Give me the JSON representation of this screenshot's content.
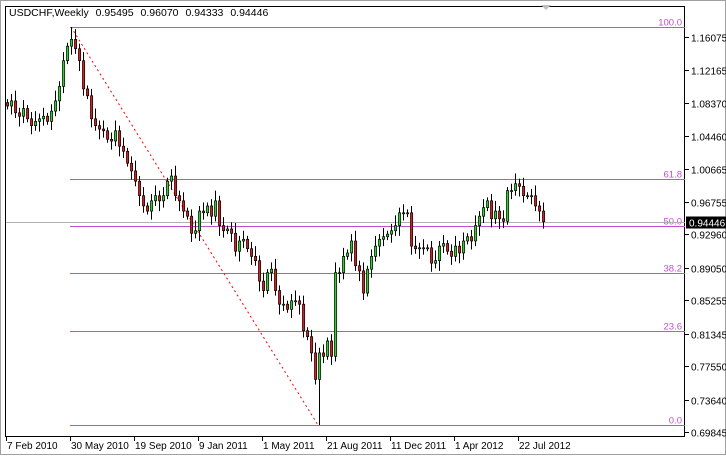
{
  "header": {
    "symbol_timeframe": "USDCHF,Weekly",
    "open": "0.95495",
    "high": "0.96070",
    "low": "0.94333",
    "close": "0.94446"
  },
  "chart_data": {
    "type": "candlestick",
    "symbol": "USDCHF",
    "timeframe": "Weekly",
    "price_ticks": [
      "1.16075",
      "1.12165",
      "1.08370",
      "1.04460",
      "1.00665",
      "0.96755",
      "0.92960",
      "0.89050",
      "0.85255",
      "0.81345",
      "0.77550",
      "0.73640",
      "0.69845"
    ],
    "price_tick_values": [
      1.16075,
      1.12165,
      1.0837,
      1.0446,
      1.00665,
      0.96755,
      0.9296,
      0.8905,
      0.85255,
      0.81345,
      0.7755,
      0.7364,
      0.69845
    ],
    "ylim": [
      0.6935,
      1.2
    ],
    "time_ticks": [
      {
        "label": "7 Feb 2010",
        "week": 0
      },
      {
        "label": "30 May 2010",
        "week": 16
      },
      {
        "label": "19 Sep 2010",
        "week": 32
      },
      {
        "label": "9 Jan 2011",
        "week": 48
      },
      {
        "label": "1 May 2011",
        "week": 64
      },
      {
        "label": "21 Aug 2011",
        "week": 80
      },
      {
        "label": "11 Dec 2011",
        "week": 96
      },
      {
        "label": "1 Apr 2012",
        "week": 112
      },
      {
        "label": "22 Jul 2012",
        "week": 128
      }
    ],
    "current_price": {
      "label": "0.94446",
      "value": 0.94446
    },
    "swing_high": {
      "value": 1.1725,
      "week": 16
    },
    "swing_low": {
      "value": 0.7066,
      "week": 78
    },
    "fibonacci": [
      {
        "label": "100.0",
        "value": 1.1725
      },
      {
        "label": "61.8",
        "value": 0.9946
      },
      {
        "label": "50.0",
        "value": 0.9396
      },
      {
        "label": "38.2",
        "value": 0.8846
      },
      {
        "label": "23.6",
        "value": 0.8166
      },
      {
        "label": "0.0",
        "value": 0.7066
      }
    ],
    "closes": [
      1.08,
      1.086,
      1.072,
      1.068,
      1.077,
      1.065,
      1.057,
      1.062,
      1.065,
      1.068,
      1.062,
      1.074,
      1.086,
      1.103,
      1.133,
      1.15,
      1.158,
      1.147,
      1.133,
      1.1,
      1.092,
      1.065,
      1.057,
      1.053,
      1.051,
      1.041,
      1.039,
      1.051,
      1.033,
      1.027,
      1.013,
      1.004,
      0.992,
      0.975,
      0.963,
      0.957,
      0.969,
      0.975,
      0.969,
      0.975,
      0.992,
      0.998,
      0.975,
      0.969,
      0.957,
      0.951,
      0.931,
      0.934,
      0.957,
      0.955,
      0.963,
      0.951,
      0.969,
      0.94,
      0.934,
      0.936,
      0.931,
      0.91,
      0.922,
      0.924,
      0.913,
      0.904,
      0.899,
      0.875,
      0.864,
      0.885,
      0.889,
      0.864,
      0.848,
      0.848,
      0.842,
      0.852,
      0.852,
      0.848,
      0.817,
      0.81,
      0.791,
      0.76,
      0.791,
      0.787,
      0.805,
      0.787,
      0.885,
      0.885,
      0.904,
      0.908,
      0.922,
      0.893,
      0.887,
      0.861,
      0.889,
      0.904,
      0.916,
      0.924,
      0.927,
      0.93,
      0.934,
      0.94,
      0.955,
      0.954,
      0.955,
      0.916,
      0.913,
      0.914,
      0.914,
      0.914,
      0.896,
      0.899,
      0.916,
      0.919,
      0.91,
      0.904,
      0.916,
      0.908,
      0.922,
      0.927,
      0.922,
      0.94,
      0.951,
      0.961,
      0.969,
      0.948,
      0.957,
      0.948,
      0.945,
      0.981,
      0.981,
      0.989,
      0.986,
      0.975,
      0.975,
      0.975,
      0.963,
      0.957,
      0.94446
    ],
    "colors": {
      "bull": "#30d030",
      "bear": "#d02020",
      "fib": "#c050d0",
      "trendline": "#ff0000",
      "current_line": "#b0b0b0"
    }
  }
}
